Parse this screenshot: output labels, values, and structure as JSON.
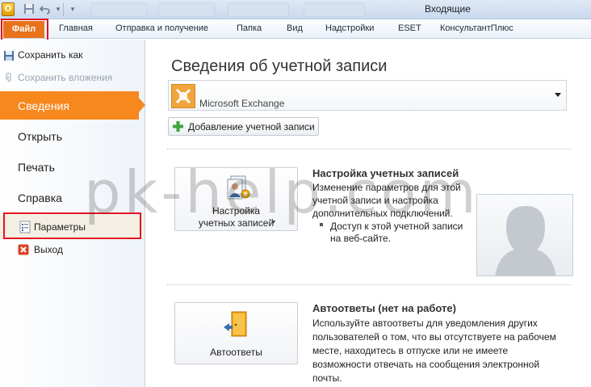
{
  "window": {
    "title": "Входящие",
    "app_icon_letter": "O"
  },
  "quick_access": {
    "save_icon": "save-icon",
    "undo_icon": "undo-icon",
    "dropdown_icon": "qat-dropdown-icon"
  },
  "ribbon": {
    "file_tab": "Файл",
    "tabs": [
      "Главная",
      "Отправка и получение",
      "Папка",
      "Вид",
      "Надстройки",
      "ESET",
      "КонсультантПлюс"
    ]
  },
  "nav": {
    "save_as": "Сохранить как",
    "save_attachments": "Сохранить вложения",
    "info": "Сведения",
    "open": "Открыть",
    "print": "Печать",
    "help": "Справка",
    "options": "Параметры",
    "exit": "Выход"
  },
  "main": {
    "heading": "Сведения об учетной записи",
    "account_name": "Microsoft Exchange",
    "add_account": "Добавление учетной записи",
    "account_settings": {
      "button_line1": "Настройка",
      "button_line2": "учетных записей",
      "title": "Настройка учетных записей",
      "desc1": "Изменение параметров для этой",
      "desc2": "учетной записи и настройка",
      "desc3": "дополнительных подключений.",
      "desc4": "Доступ к этой учетной записи",
      "desc5": "на веб-сайте."
    },
    "auto_reply": {
      "button": "Автоответы",
      "title": "Автоответы (нет на работе)",
      "desc1": "Используйте автоответы для уведомления других",
      "desc2": "пользователей о том, что вы отсутствуете на рабочем",
      "desc3": "месте, находитесь в отпуске или не имеете",
      "desc4": "возможности отвечать на сообщения электронной",
      "desc5": "почты."
    }
  },
  "watermark": "pk-help.com",
  "colors": {
    "accent": "#f6881e",
    "file_tab": "#e8731b",
    "highlight": "#e2141d"
  }
}
